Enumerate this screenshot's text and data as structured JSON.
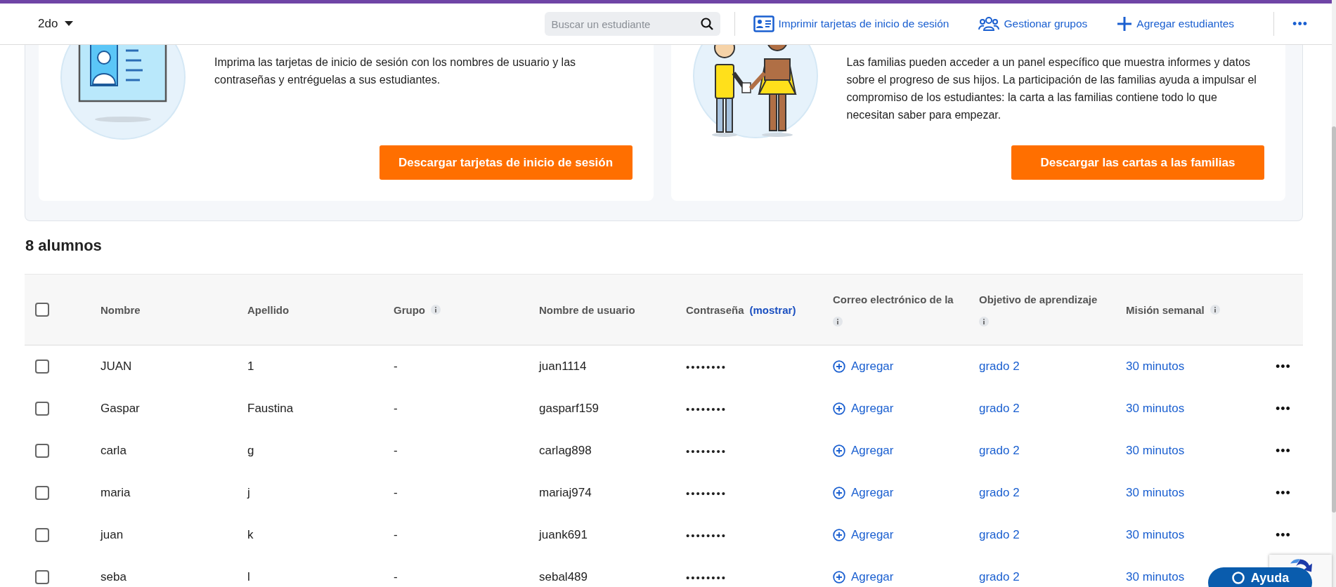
{
  "class_selector": {
    "label": "2do"
  },
  "search": {
    "placeholder": "Buscar un estudiante"
  },
  "toolbar": [
    {
      "kind": "idcard",
      "label": "Imprimir tarjetas de inicio de sesión"
    },
    {
      "kind": "group",
      "label": "Gestionar grupos"
    },
    {
      "kind": "plus",
      "label": "Agregar estudiantes"
    }
  ],
  "more_menu": "•••",
  "cards": [
    {
      "kind": "idcard",
      "text": "Imprima las tarjetas de inicio de sesión con los nombres de usuario y las contraseñas y entréguelas a sus estudiantes.",
      "button": "Descargar tarjetas de inicio de sesión"
    },
    {
      "kind": "family",
      "text": "Las familias pueden acceder a un panel específico que muestra informes y datos sobre el progreso de sus hijos. La participación de las familias ayuda a impulsar el compromiso de los estudiantes: la carta a las familias contiene todo lo que necesitan saber para empezar.",
      "button": "Descargar las cartas a las familias"
    }
  ],
  "heading": "8 alumnos",
  "table": {
    "select_all": {
      "checked": false
    },
    "columns": [
      {
        "label": "Nombre"
      },
      {
        "label": "Apellido"
      },
      {
        "label": "Grupo",
        "info": true
      },
      {
        "label": "Nombre de usuario"
      },
      {
        "label": "Contraseña",
        "link": "(mostrar)"
      },
      {
        "label": "Correo electrónico de la",
        "info": true,
        "stacked": true
      },
      {
        "label": "Objetivo de aprendizaje",
        "info": true,
        "stacked": true
      },
      {
        "label": "Misión semanal",
        "info": true
      }
    ],
    "rows": [
      {
        "checked": false,
        "cells": [
          "JUAN",
          "1",
          "-",
          "juan1114",
          "••••••••"
        ],
        "email_action": "Agregar",
        "goal": "grado 2",
        "mission": "30 minutos",
        "menu": "•••"
      },
      {
        "checked": false,
        "cells": [
          "Gaspar",
          "Faustina",
          "-",
          "gasparf159",
          "••••••••"
        ],
        "email_action": "Agregar",
        "goal": "grado 2",
        "mission": "30 minutos",
        "menu": "•••"
      },
      {
        "checked": false,
        "cells": [
          "carla",
          "g",
          "-",
          "carlag898",
          "••••••••"
        ],
        "email_action": "Agregar",
        "goal": "grado 2",
        "mission": "30 minutos",
        "menu": "•••"
      },
      {
        "checked": false,
        "cells": [
          "maria",
          "j",
          "-",
          "mariaj974",
          "••••••••"
        ],
        "email_action": "Agregar",
        "goal": "grado 2",
        "mission": "30 minutos",
        "menu": "•••"
      },
      {
        "checked": false,
        "cells": [
          "juan",
          "k",
          "-",
          "juank691",
          "••••••••"
        ],
        "email_action": "Agregar",
        "goal": "grado 2",
        "mission": "30 minutos",
        "menu": "•••"
      },
      {
        "checked": false,
        "cells": [
          "seba",
          "l",
          "-",
          "sebal489",
          "••••••••"
        ],
        "email_action": "Agregar",
        "goal": "grado 2",
        "mission": "30 minutos"
      }
    ]
  },
  "help_button": {
    "label": "Ayuda"
  }
}
